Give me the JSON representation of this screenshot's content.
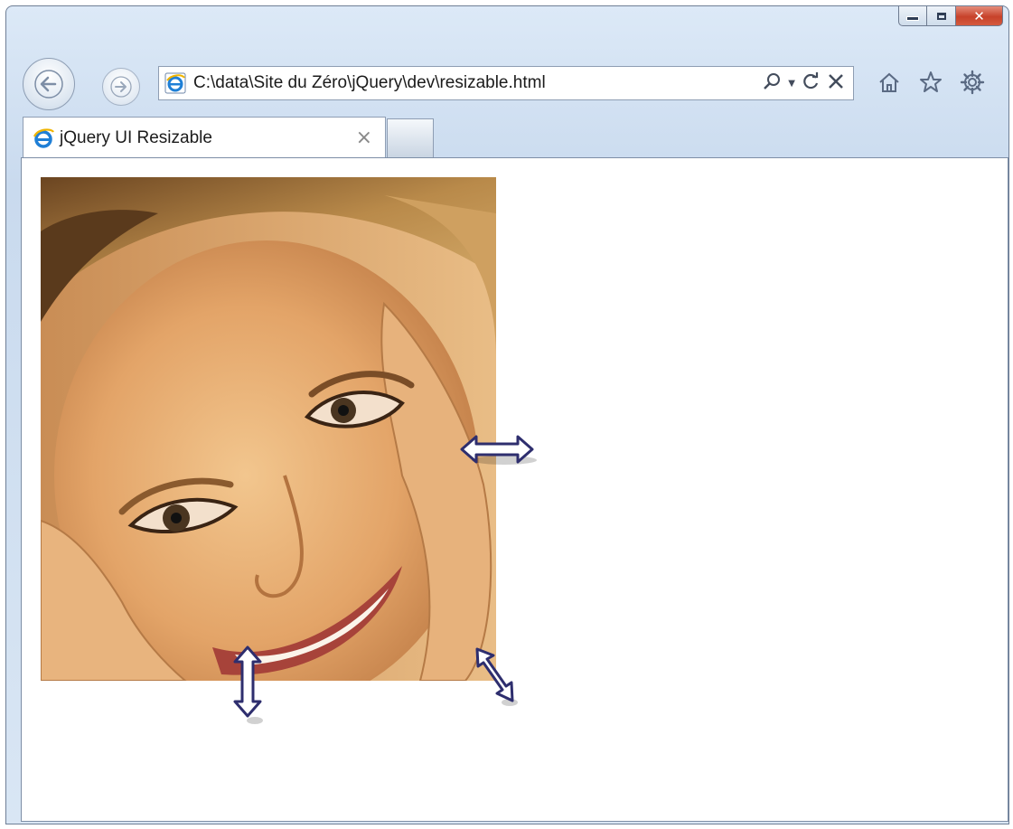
{
  "window": {
    "caption_buttons": {
      "minimize": "minimize",
      "maximize": "maximize",
      "close": "close"
    }
  },
  "address_bar": {
    "url": "C:\\data\\Site du Zéro\\jQuery\\dev\\resizable.html"
  },
  "tabs": [
    {
      "title": "jQuery UI Resizable",
      "active": true
    }
  ],
  "toolbar_icons": [
    "home-icon",
    "favorites-star-icon",
    "tools-gear-icon"
  ],
  "content": {
    "image": "portrait-photo",
    "resize_cursors": [
      "horizontal-resize",
      "vertical-resize",
      "diagonal-resize"
    ]
  },
  "colors": {
    "cursor_fill": "#ffffff",
    "cursor_stroke": "#2e2e6e",
    "close_button": "#c7422a",
    "chrome": "#d9e6f4"
  }
}
